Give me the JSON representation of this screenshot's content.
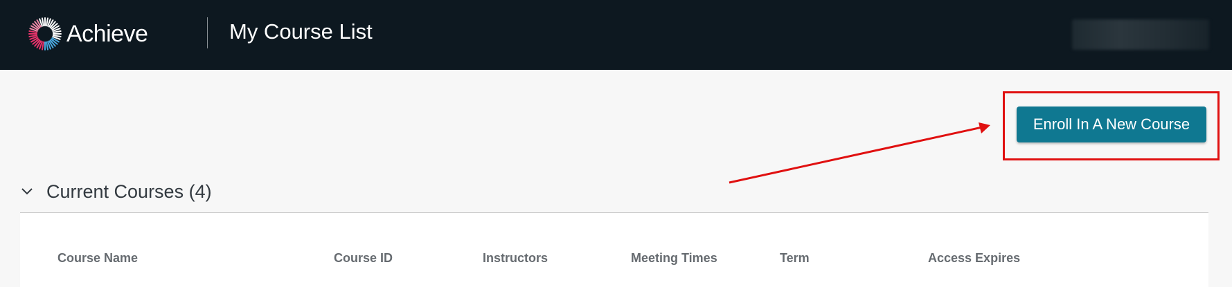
{
  "header": {
    "logo_text": "Achieve",
    "page_title": "My Course List",
    "user_menu_label": ""
  },
  "actions": {
    "enroll_label": "Enroll In A New Course"
  },
  "section": {
    "title": "Current Courses (4)"
  },
  "table": {
    "columns": [
      "Course Name",
      "Course ID",
      "Instructors",
      "Meeting Times",
      "Term",
      "Access Expires"
    ]
  },
  "colors": {
    "header_bg": "#0d1820",
    "accent": "#0f7891",
    "annotation": "#e01010"
  },
  "icons": {
    "logo": "burst-ring-logo-icon",
    "section_toggle": "chevron-down-icon"
  }
}
